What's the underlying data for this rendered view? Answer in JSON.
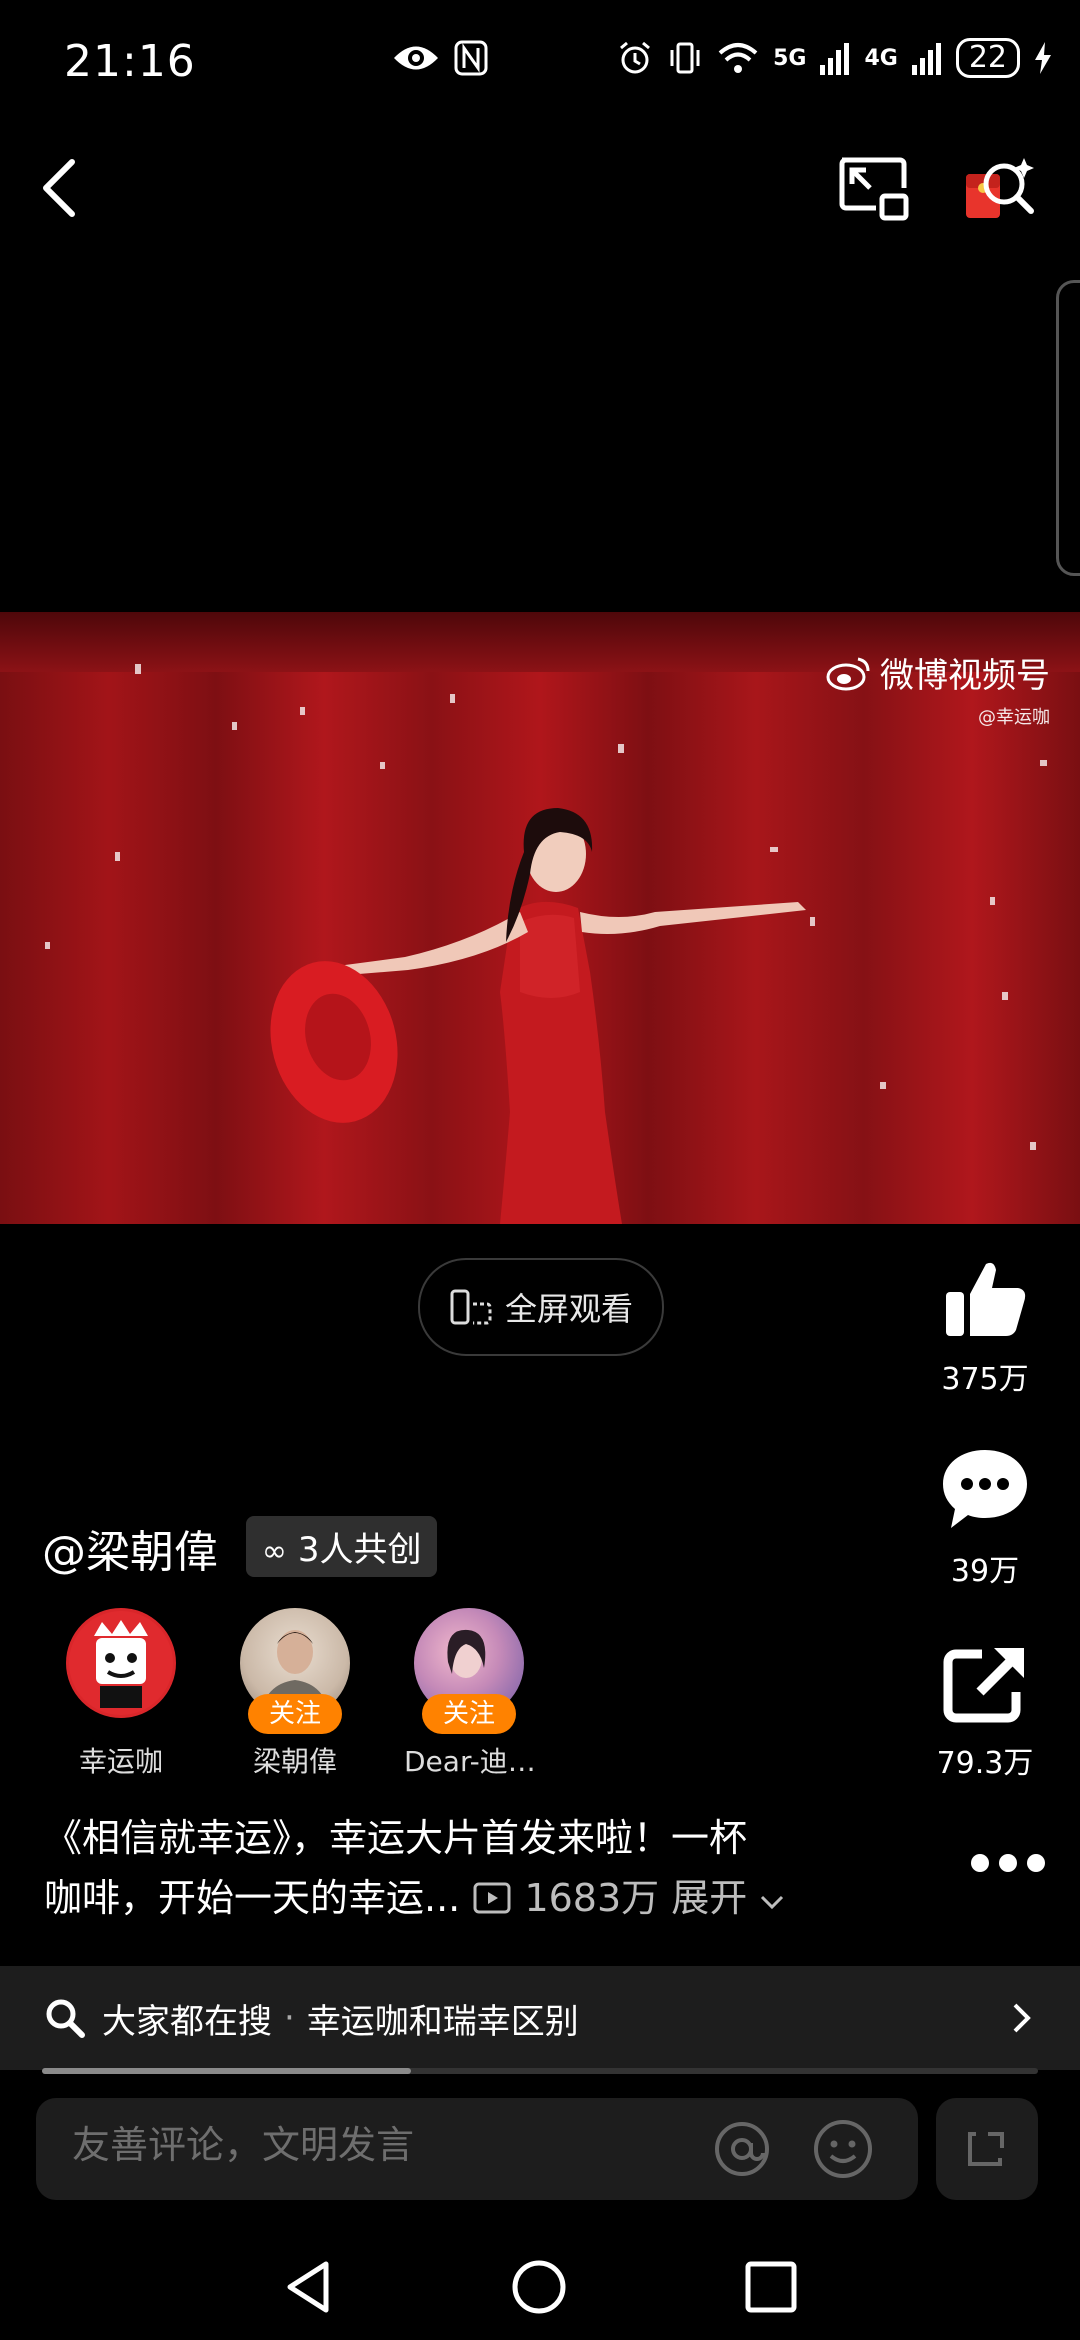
{
  "status": {
    "time": "21:16",
    "net1": "5G",
    "net2": "4G",
    "battery": "22"
  },
  "video": {
    "watermark": "微博视频号",
    "watermark_sub": "@幸运咖"
  },
  "fullscreen_label": "全屏观看",
  "actions": {
    "likes": "375万",
    "comments": "39万",
    "shares": "79.3万"
  },
  "author": {
    "handle": "@梁朝偉",
    "cocreate": "3人共创"
  },
  "creators": [
    {
      "name": "幸运咖",
      "follow": ""
    },
    {
      "name": "梁朝偉",
      "follow": "关注"
    },
    {
      "name": "Dear-迪…",
      "follow": "关注"
    }
  ],
  "description": {
    "line1": "《相信就幸运》，幸运大片首发来啦！一杯",
    "line2": "咖啡，开始一天的幸运...",
    "views": "1683万",
    "expand": "展开"
  },
  "search": {
    "prefix": "大家都在搜",
    "dot": "·",
    "query": "幸运咖和瑞幸区别"
  },
  "progress": 0.37,
  "comment": {
    "placeholder": "友善评论，文明发言"
  }
}
